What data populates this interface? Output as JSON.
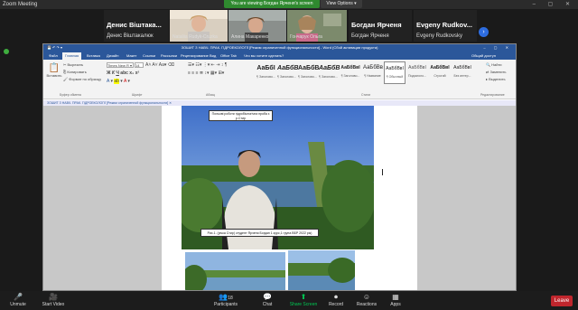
{
  "window": {
    "title": "Zoom Meeting"
  },
  "banner": {
    "sharing_text": "You are viewing Богдан Ярченя's screen",
    "view_options": "View Options"
  },
  "gallery": {
    "participants": [
      {
        "big_name": "Денис Віштака...",
        "label": "Денис Віштакалюк"
      },
      {
        "label": "Nataliia Rudyk-Cruzka"
      },
      {
        "label": "Алина Макаренко"
      },
      {
        "label": "Гончарук Ольга"
      },
      {
        "big_name": "Богдан Ярченя",
        "label": "Богдан Ярченя"
      },
      {
        "big_name": "Evgeny Rudkov...",
        "label": "Evgeny Rudkovsky"
      }
    ]
  },
  "word": {
    "title": "ЗОШИТ З НАВЧ. ПРАК. ГІДРОЕКОЛОГІЇ [Режим ограниченной функциональности] - Word (Сбой активации продукта)",
    "tabs": [
      "Файл",
      "Главная",
      "Вставка",
      "Дизайн",
      "Макет",
      "Ссылки",
      "Рассылки",
      "Рецензирование",
      "Вид",
      "Office Tab",
      "Что вы хотите сделать?",
      "Общий доступ"
    ],
    "clipboard": {
      "paste": "Вставить",
      "cut": "Вырезать",
      "copy": "Копировать",
      "format": "Формат по образцу",
      "group": "Буфер обмена"
    },
    "font": {
      "name": "Times New R",
      "size": "14",
      "group": "Шрифт"
    },
    "paragraph_group": "Абзац",
    "styles": [
      {
        "sample": "АаБбІ",
        "caption": "¶ Заголово..."
      },
      {
        "sample": "АаБбВ",
        "caption": "¶ Заголово..."
      },
      {
        "sample": "АаБбВ",
        "caption": "¶ Заголово..."
      },
      {
        "sample": "АаБбВ",
        "caption": "¶ Заголово..."
      },
      {
        "sample": "АаБбВвІ",
        "caption": "¶ Заголово..."
      },
      {
        "sample": "АаБбВв",
        "caption": "¶ Название"
      },
      {
        "sample": "АаБбВвІ",
        "caption": "¶ Обычный"
      },
      {
        "sample": "АаБбВвІ",
        "caption": "Подзаголо..."
      },
      {
        "sample": "АаБбВвІ",
        "caption": "Строгий"
      },
      {
        "sample": "АаБбВвІ",
        "caption": "Без интер..."
      }
    ],
    "styles_group": "Стили",
    "editing": {
      "find": "Найти",
      "replace": "Заменить",
      "select": "Выделить",
      "group": "Редактирование"
    },
    "doc_tab": "ЗОШИТ З НАВЧ. ПРАК. ГІДРОЕКОЛОГІЇ [Режим ограниченной функциональности]",
    "caption_top": "Польові роботи гідробіологічна проба з р.Стир",
    "caption_bottom": "Рис.1. (річка Стир) студент Ярченя Богдан 1 курс,1 група ВБР 2022 рік)"
  },
  "toolbar": {
    "unmute": "Unmute",
    "start_video": "Start Video",
    "participants": "Participants",
    "participants_count": "18",
    "chat": "Chat",
    "share_screen": "Share Screen",
    "record": "Record",
    "reactions": "Reactions",
    "apps": "Apps",
    "leave": "Leave"
  },
  "colors": {
    "word_blue": "#2b579a",
    "zoom_green": "#2f8a2f",
    "share_green": "#00c853",
    "leave_red": "#c0262d"
  }
}
